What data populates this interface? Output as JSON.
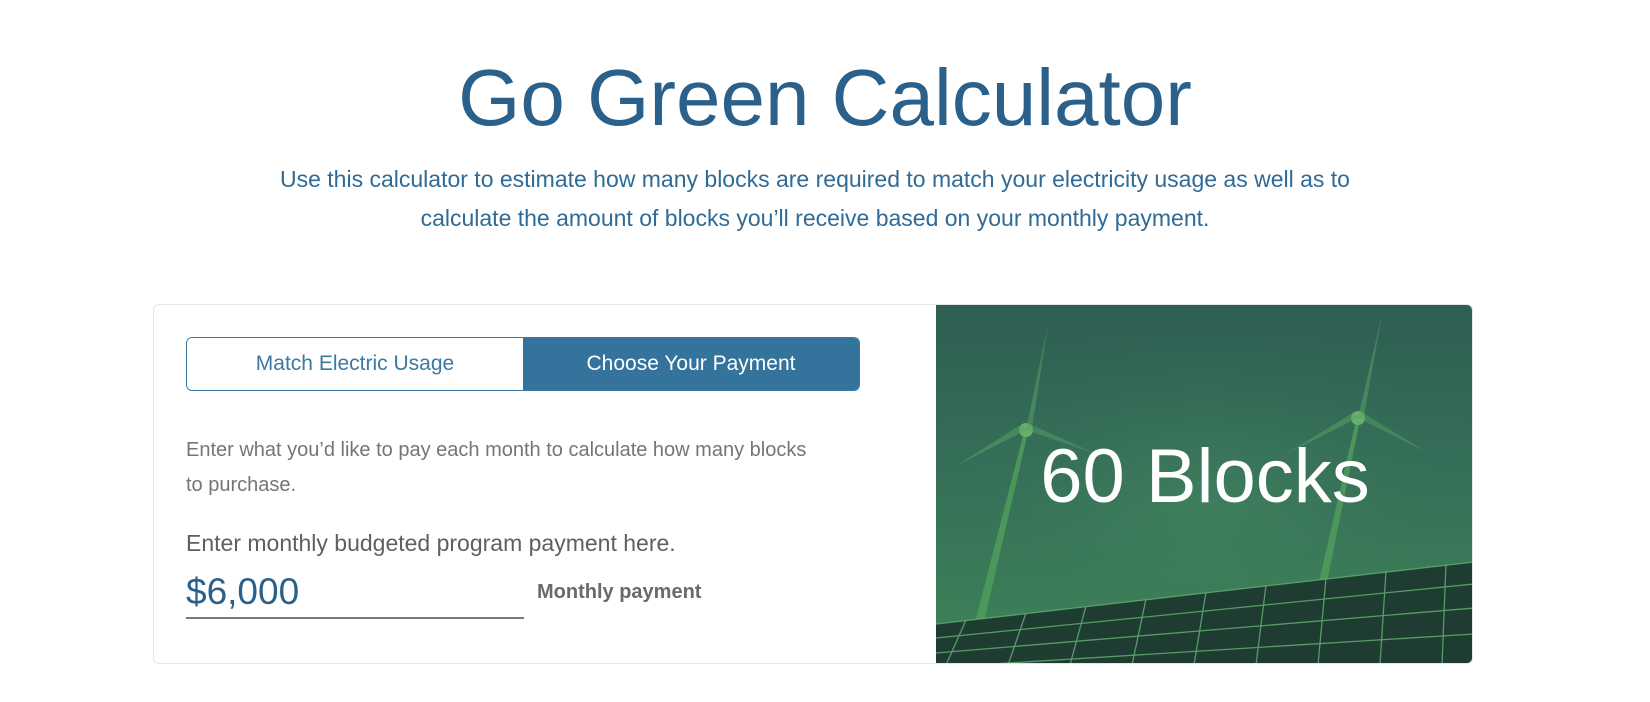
{
  "header": {
    "title": "Go Green Calculator",
    "subtitle": "Use this calculator to estimate how many blocks are required to match your electricity usage as well as to calculate the amount of blocks you’ll receive based on your monthly payment."
  },
  "calculator": {
    "tabs": [
      {
        "label": "Match Electric Usage",
        "active": false
      },
      {
        "label": "Choose Your Payment",
        "active": true
      }
    ],
    "instructions": "Enter what you’d like to pay each month to calculate how many blocks to purchase.",
    "field_label": "Enter monthly budgeted program payment here.",
    "payment_value": "$6,000",
    "payment_suffix": "Monthly payment"
  },
  "result": {
    "text": "60 Blocks",
    "background_image": "wind-turbines-solar-panels"
  },
  "colors": {
    "brand_blue": "#2a6089",
    "tab_active": "#34739c",
    "panel_green": "#356f58"
  }
}
